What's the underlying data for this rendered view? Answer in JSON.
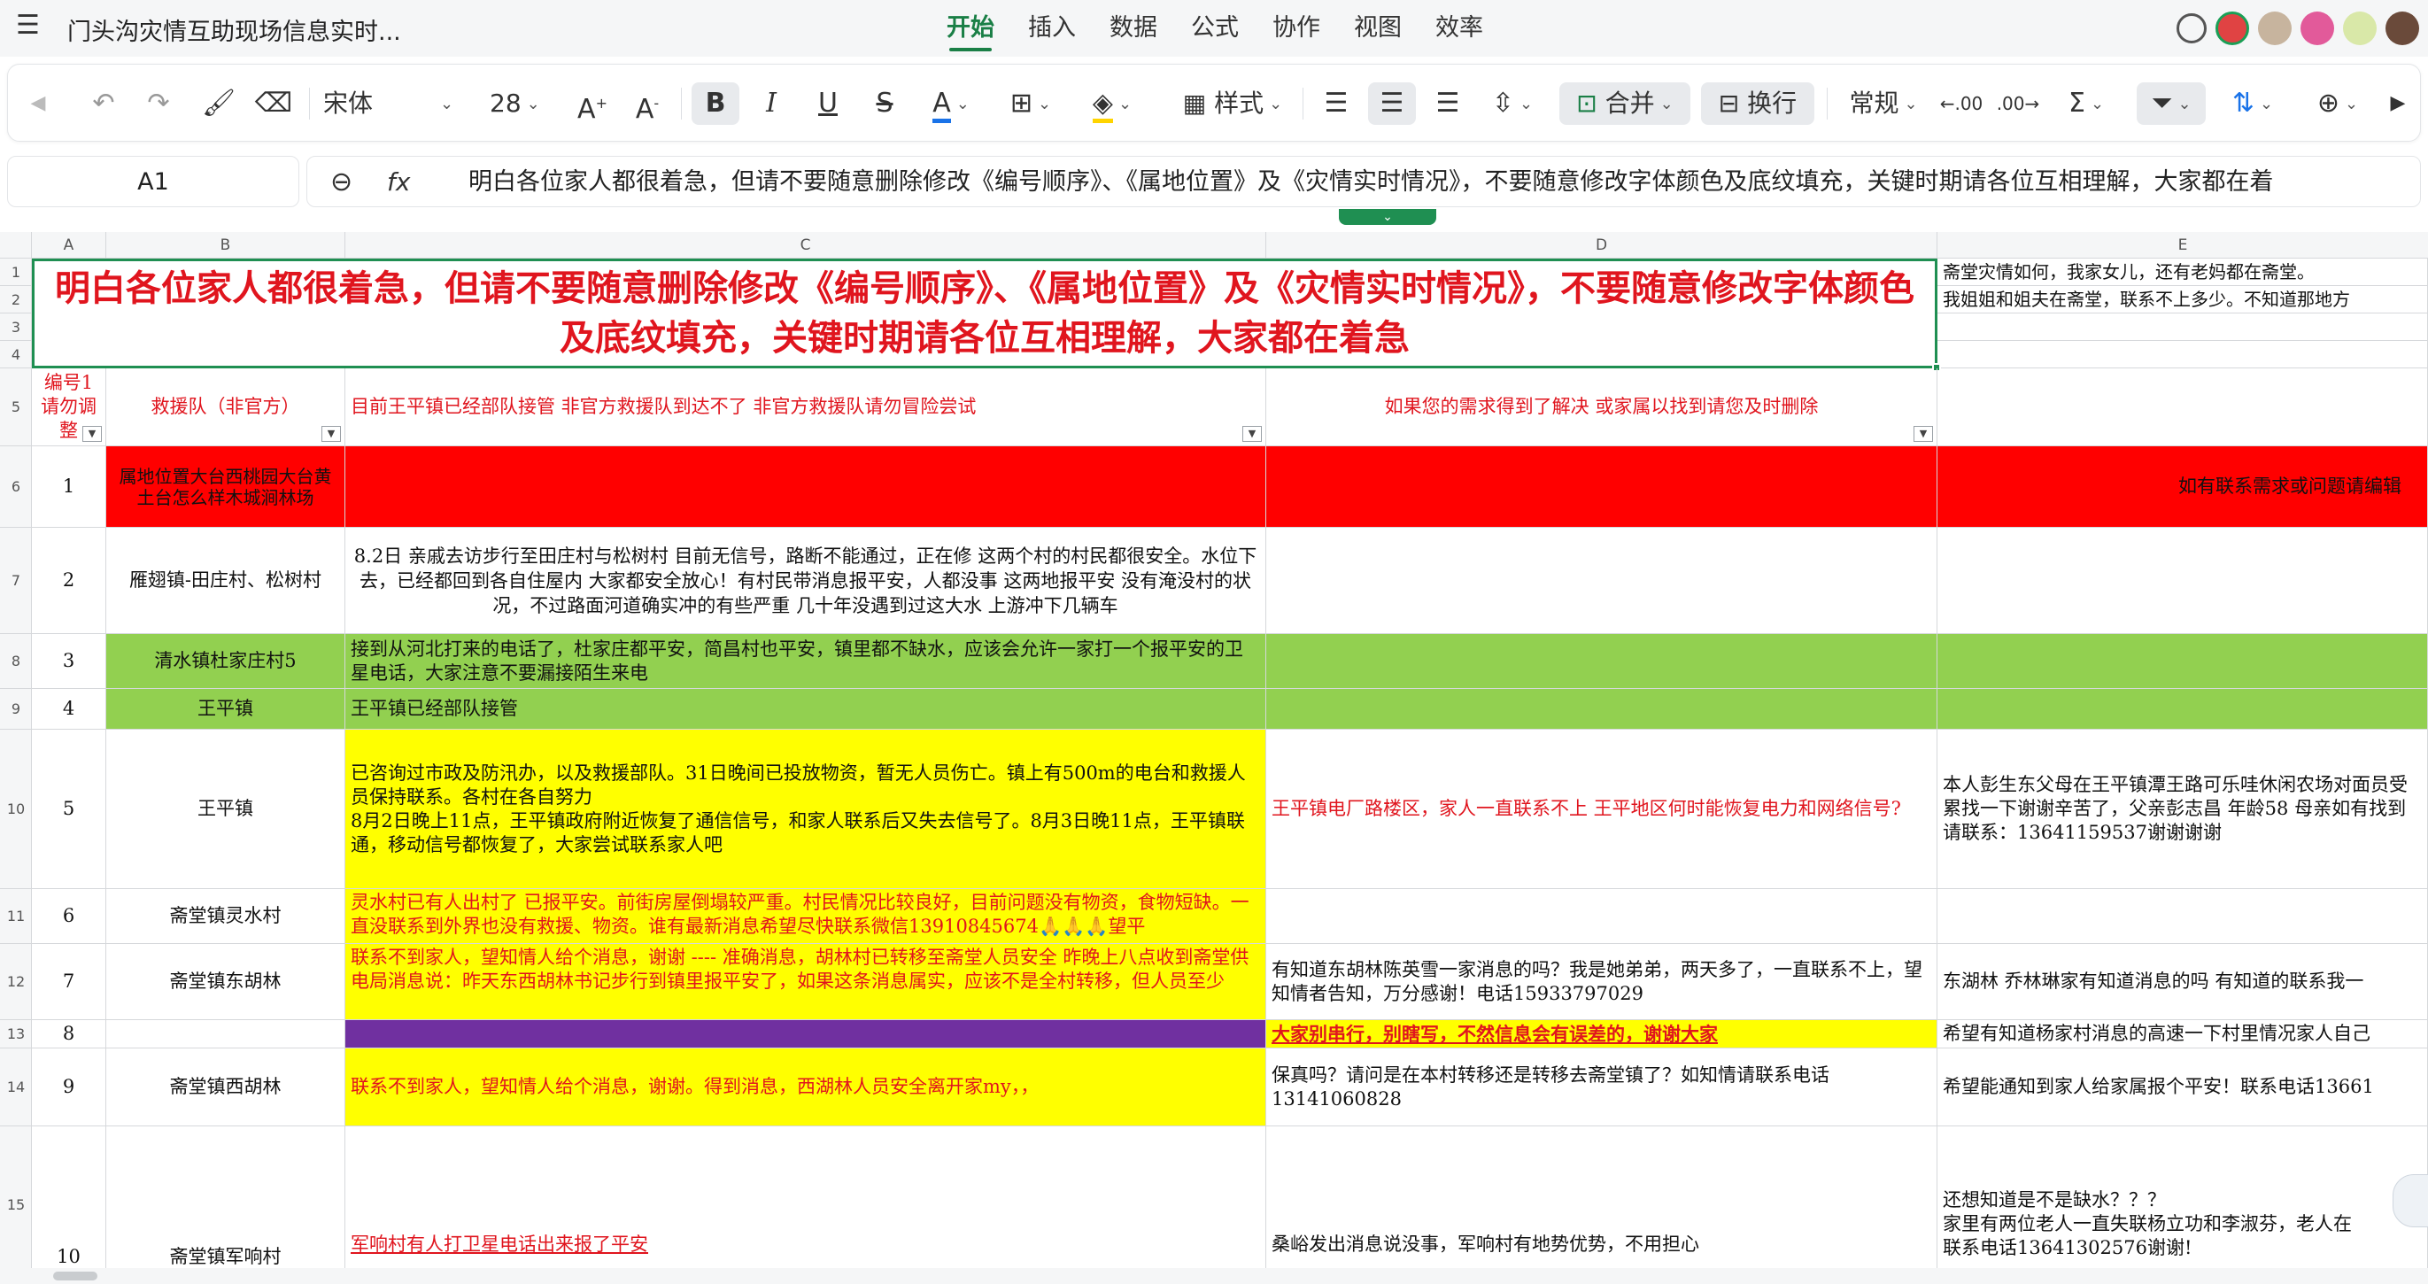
{
  "menubar": {
    "title": "门头沟灾情互助现场信息实时...",
    "tabs": [
      "开始",
      "插入",
      "数据",
      "公式",
      "协作",
      "视图",
      "效率"
    ]
  },
  "toolbar": {
    "font": "宋体",
    "size": "28",
    "style_label": "样式",
    "merge_label": "合并",
    "wrap_label": "换行",
    "number_format": "常规"
  },
  "formula_bar": {
    "cell_ref": "A1",
    "content": "明白各位家人都很着急，但请不要随意删除修改《编号顺序》、《属地位置》及《灾情实时情况》，不要随意修改字体颜色及底纹填充，关键时期请各位互相理解，大家都在着"
  },
  "columns": [
    "A",
    "B",
    "C",
    "D",
    "E"
  ],
  "rows": [
    "1",
    "2",
    "3",
    "4",
    "5",
    "6",
    "7",
    "8",
    "9",
    "10",
    "11",
    "12",
    "13",
    "14",
    "15"
  ],
  "sheet": {
    "banner": "明白各位家人都很着急，但请不要随意删除修改《编号顺序》、《属地位置》及《灾情实时情况》，不要随意修改字体颜色及底纹填充，关键时期请各位互相理解，大家都在着急",
    "e1": "斋堂灾情如何，我家女儿，还有老妈都在斋堂。",
    "e2": "我姐姐和姐夫在斋堂，联系不上多少。不知道那地方",
    "header": {
      "a": "编号1请勿调整",
      "b": "救援队（非官方）",
      "c": "目前王平镇已经部队接管  非官方救援队到达不了  非官方救援队请勿冒险尝试",
      "d": "如果您的需求得到了解决  或家属以找到请您及时删除"
    },
    "r6": {
      "a": "1",
      "b": "属地位置大台西桃园大台黄土台怎么样木城涧林场",
      "e": "如有联系需求或问题请编辑"
    },
    "r7": {
      "a": "2",
      "b": "雁翅镇-田庄村、松树村",
      "c": "8.2日 亲戚去访步行至田庄村与松树村   目前无信号，路断不能通过，正在修  这两个村的村民都很安全。水位下去，已经都回到各自住屋内  大家都安全放心！有村民带消息报平安，人都没事  这两地报平安  没有淹没村的状况，不过路面河道确实冲的有些严重  几十年没遇到过这大水  上游冲下几辆车"
    },
    "r8": {
      "a": "3",
      "b": "清水镇杜家庄村5",
      "c": "接到从河北打来的电话了，杜家庄都平安，简昌村也平安，镇里都不缺水，应该会允许一家打一个报平安的卫星电话，大家注意不要漏接陌生来电"
    },
    "r9": {
      "a": "4",
      "b": "王平镇",
      "c": "王平镇已经部队接管"
    },
    "r10": {
      "a": "5",
      "b": "王平镇",
      "c": "已咨询过市政及防汛办，以及救援部队。31日晚间已投放物资，暂无人员伤亡。镇上有500m的电台和救援人员保持联系。各村在各自努力\n8月2日晚上11点，王平镇政府附近恢复了通信信号，和家人联系后又失去信号了。8月3日晚11点，王平镇联通，移动信号都恢复了，大家尝试联系家人吧",
      "d": "王平镇电厂路楼区，家人一直联系不上 王平地区何时能恢复电力和网络信号?",
      "e": "本人彭生东父母在王平镇潭王路可乐哇休闲农场对面员受累找一下谢谢辛苦了，父亲彭志昌 年龄58 母亲如有找到请联系：13641159537谢谢谢谢"
    },
    "r11": {
      "a": "6",
      "b": "斋堂镇灵水村",
      "c": "灵水村已有人出村了 已报平安。前街房屋倒塌较严重。村民情况比较良好，目前问题没有物资，食物短缺。一直没联系到外界也没有救援、物资。谁有最新消息希望尽快联系微信13910845674🙏🙏🙏望平"
    },
    "r12": {
      "a": "7",
      "b": "斋堂镇东胡林",
      "c": "联系不到家人，望知情人给个消息，谢谢 ----   准确消息，胡林村已转移至斋堂人员安全  昨晚上八点收到斋堂供电局消息说：昨天东西胡林书记步行到镇里报平安了，如果这条消息属实，应该不是全村转移，但人员至少",
      "d": "有知道东胡林陈英雪一家消息的吗？我是她弟弟，两天多了，一直联系不上，望知情者告知，万分感谢！电话15933797029",
      "e": "东湖林 乔林琳家有知道消息的吗 有知道的联系我一"
    },
    "r13": {
      "a": "8",
      "d": "大家别串行，别瞎写，不然信息会有误差的，谢谢大家",
      "e": "希望有知道杨家村消息的高速一下村里情况家人自己"
    },
    "r14": {
      "a": "9",
      "b": "斋堂镇西胡林",
      "c": "联系不到家人，望知情人给个消息，谢谢。得到消息，西湖林人员安全离开家my，，",
      "d": "保真吗？请问是在本村转移还是转移去斋堂镇了？如知情请联系电话13141060828",
      "e": "希望能通知到家人给家属报个平安！联系电话13661"
    },
    "r15": {
      "a": "10",
      "b": "斋堂镇军响村",
      "c": "军响村有人打卫星电话出来报了平安",
      "d": "桑峪发出消息说没事，军响村有地势优势，不用担心",
      "e": "还想知道是不是缺水？？？\n家里有两位老人一直失联杨立功和李淑芬，老人在\n联系电话13641302576谢谢!"
    }
  }
}
